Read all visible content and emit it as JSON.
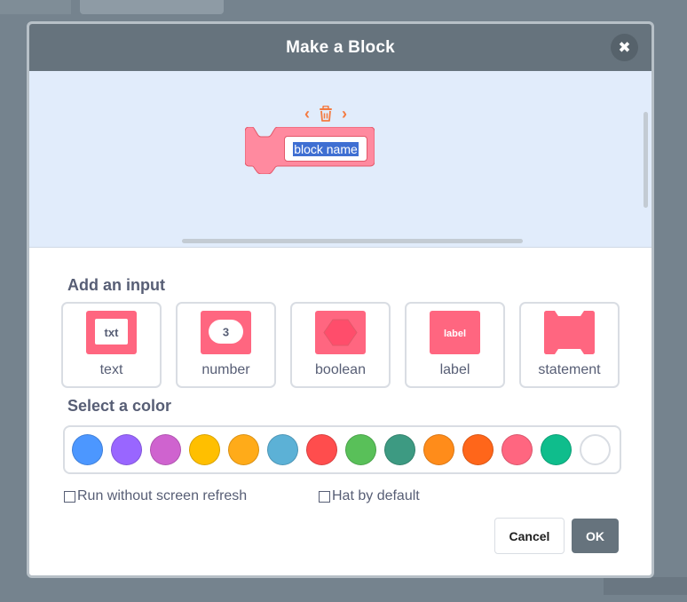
{
  "dialog": {
    "title": "Make a Block",
    "close_icon": "close-icon",
    "block_name_value": "block name"
  },
  "inputs_section": {
    "title": "Add an input",
    "options": [
      {
        "label": "text",
        "icon_text": "txt",
        "icon": "text-input-icon"
      },
      {
        "label": "number",
        "icon_text": "3",
        "icon": "number-input-icon"
      },
      {
        "label": "boolean",
        "icon": "boolean-input-icon"
      },
      {
        "label": "label",
        "icon_text": "label",
        "icon": "label-input-icon"
      },
      {
        "label": "statement",
        "icon": "statement-input-icon"
      }
    ]
  },
  "color_section": {
    "title": "Select a color",
    "colors": [
      "#4c97ff",
      "#9966ff",
      "#cf63cf",
      "#ffbf00",
      "#ffab19",
      "#5cb1d6",
      "#ff4d4d",
      "#59c059",
      "#3d9a82",
      "#ff8c1a",
      "#ff661a",
      "#ff6680",
      "#0fbd8c",
      "#ffffff"
    ]
  },
  "options": {
    "run_without_refresh": "Run without screen refresh",
    "hat_by_default": "Hat by default"
  },
  "buttons": {
    "cancel": "Cancel",
    "ok": "OK"
  },
  "theme": {
    "block_color": "#ff6680",
    "header_color": "#66737d",
    "workspace_bg": "#e1ecfb"
  }
}
